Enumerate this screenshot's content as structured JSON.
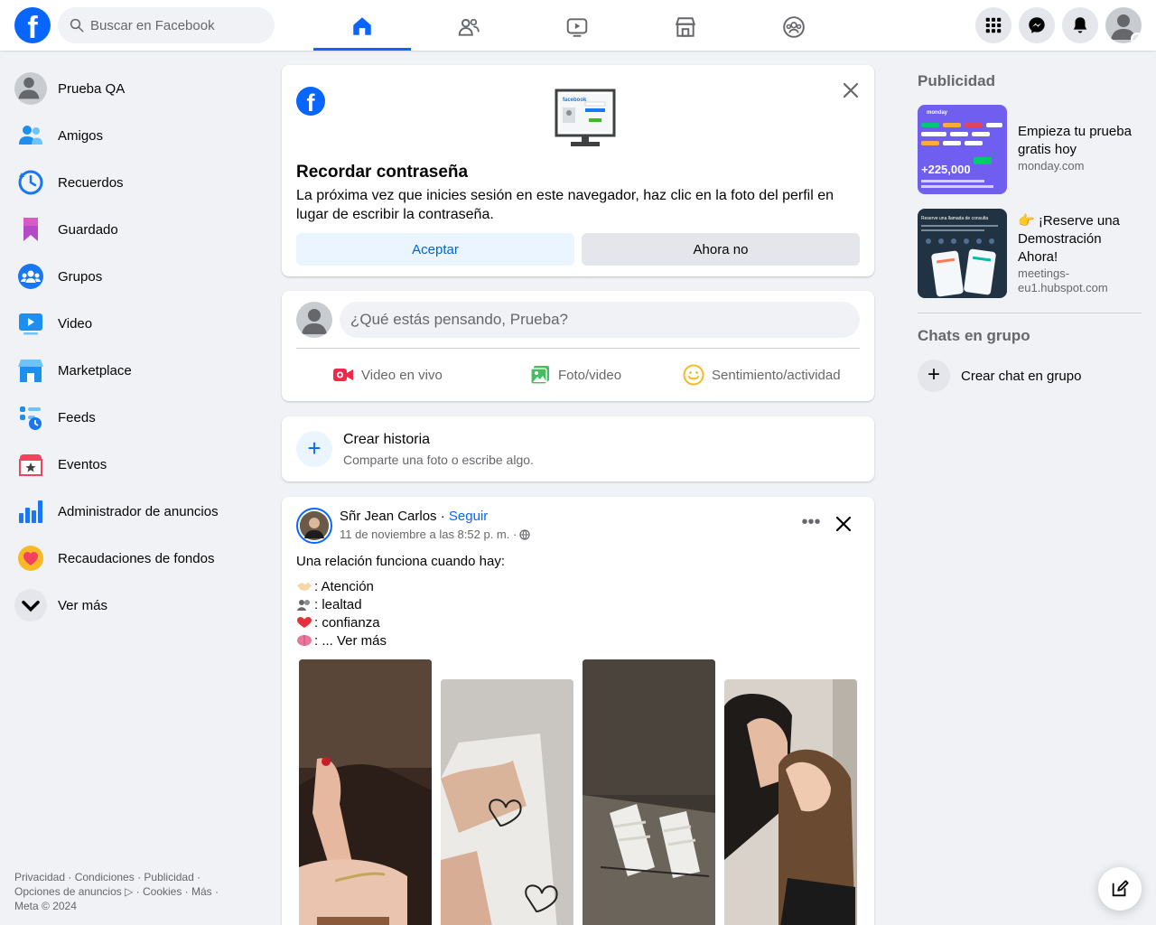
{
  "header": {
    "logo_letter": "f",
    "search_placeholder": "Buscar en Facebook"
  },
  "sidebar": {
    "items": [
      {
        "label": "Prueba QA"
      },
      {
        "label": "Amigos"
      },
      {
        "label": "Recuerdos"
      },
      {
        "label": "Guardado"
      },
      {
        "label": "Grupos"
      },
      {
        "label": "Video"
      },
      {
        "label": "Marketplace"
      },
      {
        "label": "Feeds"
      },
      {
        "label": "Eventos"
      },
      {
        "label": "Administrador de anuncios"
      },
      {
        "label": "Recaudaciones de fondos"
      },
      {
        "label": "Ver más"
      }
    ],
    "footer_line1": "Privacidad · Condiciones · Publicidad ·",
    "footer_line2": "Opciones de anuncios ▷ · Cookies · Más ·",
    "footer_line3": "Meta © 2024"
  },
  "password_card": {
    "logo_letter": "f",
    "title": "Recordar contraseña",
    "text": "La próxima vez que inicies sesión en este navegador, haz clic en la foto del perfil en lugar de escribir la contraseña.",
    "accept_label": "Aceptar",
    "later_label": "Ahora no",
    "monitor_brand": "facebook"
  },
  "composer": {
    "placeholder": "¿Qué estás pensando, Prueba?",
    "live_label": "Video en vivo",
    "photo_label": "Foto/video",
    "feeling_label": "Sentimiento/actividad"
  },
  "story": {
    "plus": "+",
    "title": "Crear historia",
    "subtitle": "Comparte una foto o escribe algo."
  },
  "post": {
    "author": "Sñr Jean Carlos",
    "separator": " · ",
    "follow_label": "Seguir",
    "date": "11 de noviembre a las 8:52 p. m. ·",
    "intro": "Una relación funciona cuando hay:",
    "line_atencion": ": Atención",
    "line_lealtad": ": lealtad",
    "line_confianza": ": confianza",
    "line_more": ": ... Ver más",
    "more_dots": "•••"
  },
  "right": {
    "ads_title": "Publicidad",
    "ad1_title": "Empieza tu prueba gratis hoy",
    "ad1_url": "monday.com",
    "ad1_brand": "monday",
    "ad1_stat": "+225,000",
    "ad2_title": "👉 ¡Reserve una Demostración Ahora!",
    "ad2_url_l1": "meetings-",
    "ad2_url_l2": "eu1.hubspot.com",
    "ad2_banner": "Reserve una llamada de consulta",
    "group_chats_title": "Chats en grupo",
    "new_chat_label": "Crear chat en grupo",
    "plus": "+"
  },
  "colors": {
    "brand": "#0866ff",
    "background": "#f0f2f5",
    "text_secondary": "#65676b"
  }
}
